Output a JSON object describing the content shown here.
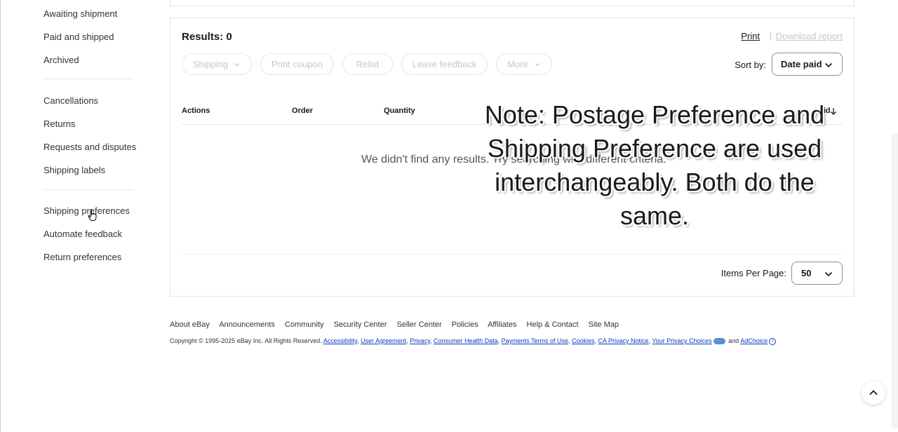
{
  "sidebar": {
    "items": [
      {
        "label": "Awaiting shipment"
      },
      {
        "label": "Paid and shipped"
      },
      {
        "label": "Archived"
      },
      {
        "label": "Cancellations"
      },
      {
        "label": "Returns"
      },
      {
        "label": "Requests and disputes"
      },
      {
        "label": "Shipping labels"
      },
      {
        "label": "Shipping preferences"
      },
      {
        "label": "Automate feedback"
      },
      {
        "label": "Return preferences"
      }
    ]
  },
  "results": {
    "title": "Results: 0",
    "print_label": "Print",
    "separator": "|",
    "download_label": "Download report"
  },
  "actions": {
    "shipping": "Shipping",
    "print_coupon": "Print coupon",
    "relist": "Relist",
    "leave_feedback": "Leave feedback",
    "more": "More"
  },
  "sort": {
    "label": "Sort by:",
    "value": "Date paid"
  },
  "table": {
    "headers": {
      "actions": "Actions",
      "order": "Order",
      "quantity": "Quantity",
      "date_paid": "paid"
    },
    "empty_message": "We didn't find any results. Try searching with different criteria."
  },
  "pagination": {
    "label": "Items Per Page:",
    "value": "50"
  },
  "note": {
    "text": "Note: Postage Preference and Shipping Preference are used interchangeably. Both do the same."
  },
  "footer": {
    "links": [
      "About eBay",
      "Announcements",
      "Community",
      "Security Center",
      "Seller Center",
      "Policies",
      "Affiliates",
      "Help & Contact",
      "Site Map"
    ],
    "copyright_prefix": "Copyright © 1995-2025 eBay Inc. All Rights Reserved.",
    "legal_links": [
      "Accessibility",
      "User Agreement",
      "Privacy",
      "Consumer Health Data",
      "Payments Terms of Use",
      "Cookies",
      "CA Privacy Notice",
      "Your Privacy Choices"
    ],
    "and_text": "and",
    "adchoice": "AdChoice"
  },
  "colors": {
    "disabled_text": "#c7c7c7",
    "link_blue": "#0f3bb8",
    "border": "#e5e5e5"
  }
}
